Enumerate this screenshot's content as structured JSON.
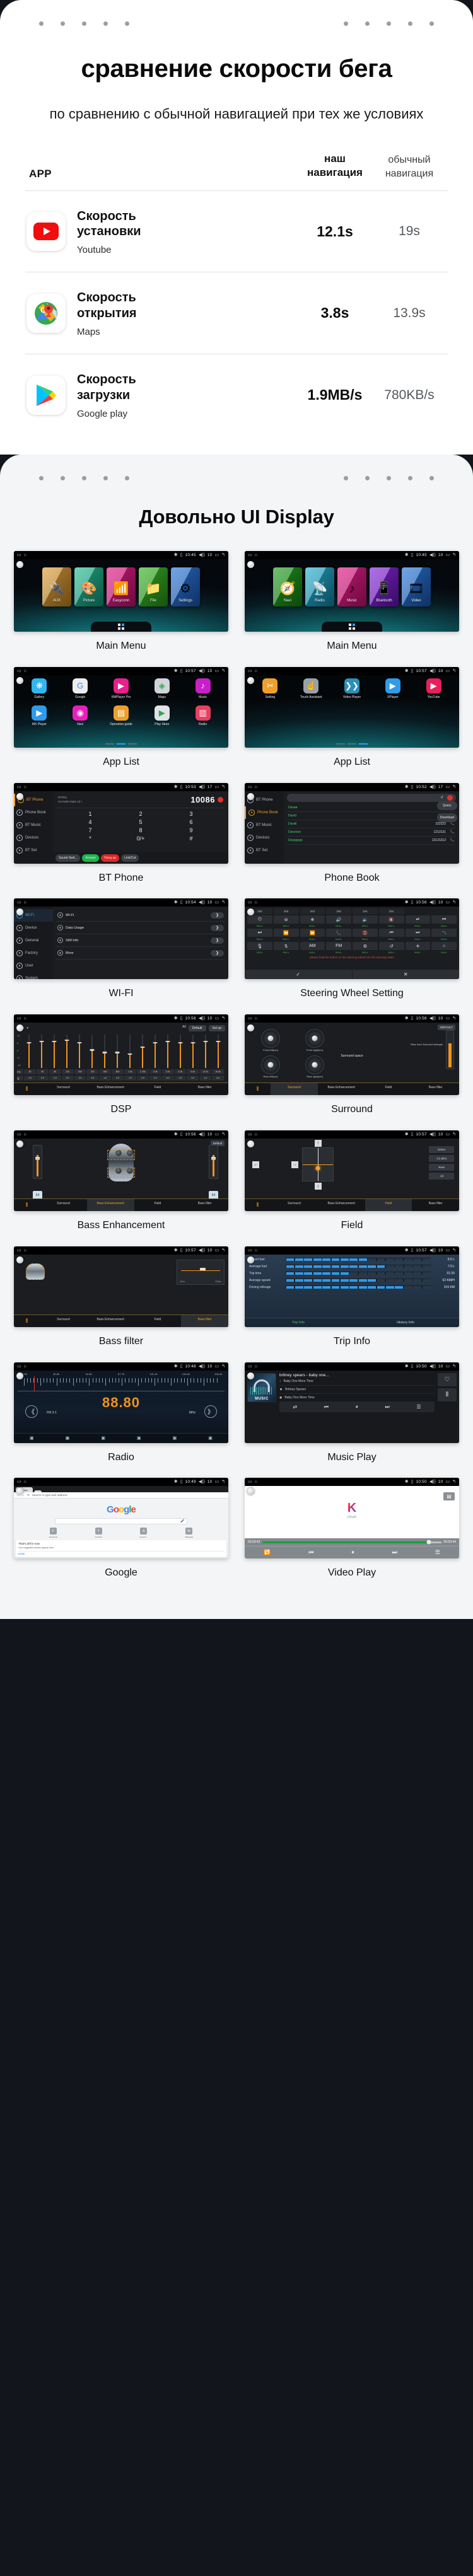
{
  "section1": {
    "title": "сравнение скорости бега",
    "subtitle": "по сравнению с обычной навигацией при тех же условиях",
    "table": {
      "header": {
        "app": "APP",
        "ours_line1": "наш",
        "ours_line2": "навигация",
        "normal_line1": "обычный",
        "normal_line2": "навигация"
      },
      "rows": [
        {
          "icon": "youtube-icon",
          "metric": "Скорость установки",
          "app": "Youtube",
          "ours": "12.1s",
          "normal": "19s"
        },
        {
          "icon": "google-maps-icon",
          "metric": "Скорость открытия",
          "app": "Maps",
          "ours": "3.8s",
          "normal": "13.9s"
        },
        {
          "icon": "google-play-icon",
          "metric": "Скорость загрузки",
          "app": "Google play",
          "ours": "1.9MB/s",
          "normal": "780KB/s"
        }
      ]
    }
  },
  "section2": {
    "title": "Довольно UI Display",
    "items": [
      {
        "caption": "Main Menu",
        "kind": "main-menu-a",
        "status": {
          "time": "10:45",
          "vol": "10"
        },
        "tiles": [
          {
            "label": "AUX",
            "icon": "rca-cables-icon",
            "c1": "#e0a341",
            "c2": "#8a5f17"
          },
          {
            "label": "Picture",
            "icon": "palette-icon",
            "c1": "#2cc39a",
            "c2": "#0c6b55"
          },
          {
            "label": "Easyconn",
            "icon": "phone-wifi-icon",
            "c1": "#e81f8c",
            "c2": "#8e0d52"
          },
          {
            "label": "File",
            "icon": "folder-search-icon",
            "c1": "#3fbc2a",
            "c2": "#1c6b12"
          },
          {
            "label": "Settings",
            "icon": "gear-icon",
            "c1": "#2f7de0",
            "c2": "#123f80"
          }
        ]
      },
      {
        "caption": "Main Menu",
        "kind": "main-menu-b",
        "status": {
          "time": "10:45",
          "vol": "10"
        },
        "tiles": [
          {
            "label": "Navi",
            "icon": "compass-icon",
            "c1": "#2aa32a",
            "c2": "#0d5f0d"
          },
          {
            "label": "Radio",
            "icon": "radio-tower-icon",
            "c1": "#2bb6d6",
            "c2": "#0d5f78"
          },
          {
            "label": "Music",
            "icon": "music-note-icon",
            "c1": "#e81f8c",
            "c2": "#8e0d52"
          },
          {
            "label": "Bluetooth",
            "icon": "bluetooth-phone-icon",
            "c1": "#8c2ce0",
            "c2": "#4a0d87"
          },
          {
            "label": "Video",
            "icon": "film-reel-icon",
            "c1": "#2f7de0",
            "c2": "#123f80"
          }
        ]
      },
      {
        "caption": "App List",
        "kind": "app-list-a",
        "status": {
          "time": "10:57",
          "vol": "10"
        },
        "apps": [
          {
            "label": "Gallery",
            "glyph": "❋",
            "bg": "#33b5f0"
          },
          {
            "label": "Google",
            "glyph": "G",
            "bg": "#ededed",
            "fg": "#4285f4"
          },
          {
            "label": "KMPlayer Pro",
            "glyph": "▶",
            "bg": "#e81f8c"
          },
          {
            "label": "Maps",
            "glyph": "◈",
            "bg": "#cfd4d8",
            "fg": "#34a853"
          },
          {
            "label": "Music",
            "glyph": "♪",
            "bg": "#c91fc9"
          },
          {
            "label": "MX Player",
            "glyph": "▶",
            "bg": "#2f9bea"
          },
          {
            "label": "Navi",
            "glyph": "◉",
            "bg": "#e81fbe"
          },
          {
            "label": "Operation guide",
            "glyph": "▤",
            "bg": "#f0a02a"
          },
          {
            "label": "Play Store",
            "glyph": "▶",
            "bg": "#dfe3e6",
            "fg": "#34a853"
          },
          {
            "label": "Radio",
            "glyph": "▥",
            "bg": "#e84060"
          }
        ],
        "page_active": 1
      },
      {
        "caption": "App List",
        "kind": "app-list-b",
        "status": {
          "time": "10:57",
          "vol": "10"
        },
        "apps": [
          {
            "label": "Setting",
            "glyph": "✂",
            "bg": "#f0a02a"
          },
          {
            "label": "Touch Assistant",
            "glyph": "☝",
            "bg": "#9aa0a6"
          },
          {
            "label": "Video Player",
            "glyph": "❯❯",
            "bg": "#2b8fb8"
          },
          {
            "label": "XPlayer",
            "glyph": "▶",
            "bg": "#2f9bea"
          },
          {
            "label": "YouTube",
            "glyph": "▶",
            "bg": "#e81f5c"
          }
        ],
        "page_active": 2
      },
      {
        "caption": "BT Phone",
        "kind": "bt-phone",
        "status": {
          "time": "10:53",
          "vol": "17"
        },
        "side": [
          {
            "label": "BT Phone",
            "icon": "dialpad-icon",
            "state": "act"
          },
          {
            "label": "Phone Book",
            "icon": "contact-icon",
            "state": ""
          },
          {
            "label": "BT Music",
            "icon": "music-note-icon",
            "state": ""
          },
          {
            "label": "Devices",
            "icon": "bluetooth-icon",
            "state": ""
          },
          {
            "label": "BT Set",
            "icon": "gear-icon",
            "state": ""
          }
        ],
        "dial": {
          "status_line1": "Dialing",
          "status_line2": "HUAWEI Mate 20 l",
          "number": "10086",
          "corner": "10086",
          "keys": [
            "1",
            "2",
            "3",
            "4",
            "5",
            "6",
            "7",
            "8",
            "9",
            "*",
            "0/+",
            "#"
          ],
          "buttons": [
            "Sound Swit...",
            "Answer",
            "Hang up",
            "Link/Cut"
          ]
        }
      },
      {
        "caption": "Phone Book",
        "kind": "phone-book",
        "status": {
          "time": "10:52",
          "vol": "17"
        },
        "side": [
          {
            "label": "BT Phone",
            "icon": "dialpad-icon",
            "state": ""
          },
          {
            "label": "Phone Book",
            "icon": "contact-icon",
            "state": "act"
          },
          {
            "label": "BT Music",
            "icon": "music-note-icon",
            "state": ""
          },
          {
            "label": "Devices",
            "icon": "bluetooth-icon",
            "state": ""
          },
          {
            "label": "BT Set",
            "icon": "gear-icon",
            "state": ""
          }
        ],
        "search_value": "d",
        "contacts": [
          {
            "name": "Davaa",
            "phone": "1111"
          },
          {
            "name": "David",
            "phone": "11111"
          },
          {
            "name": "Daviiii",
            "phone": "222222"
          },
          {
            "name": "Davoooo",
            "phone": "1213131"
          },
          {
            "name": "Davppppp",
            "phone": "12121212"
          }
        ],
        "buttons": [
          "Query",
          "Download"
        ]
      },
      {
        "caption": "WI-FI",
        "kind": "wifi",
        "status": {
          "time": "10:54",
          "vol": "10"
        },
        "side": [
          {
            "label": "Wi-Fi",
            "icon": "wifi-icon",
            "state": "actb"
          },
          {
            "label": "Device",
            "icon": "device-icon",
            "state": ""
          },
          {
            "label": "General",
            "icon": "gear-icon",
            "state": ""
          },
          {
            "label": "Factory",
            "icon": "tools-icon",
            "state": ""
          },
          {
            "label": "User",
            "icon": "user-icon",
            "state": ""
          },
          {
            "label": "System",
            "icon": "system-icon",
            "state": ""
          }
        ],
        "rows": [
          "WI-FI",
          "Data Usage",
          "SIM Info",
          "More"
        ]
      },
      {
        "caption": "Steering Wheel Setting",
        "kind": "steering",
        "status": {
          "time": "10:56",
          "vol": "10"
        },
        "values": [
          "255",
          "255",
          "253",
          "255",
          "254",
          "254"
        ],
        "keys_r1": [
          "⏻",
          "⊜",
          "❄",
          "🔊",
          "🔉",
          "🔇",
          "⏯",
          "⏮"
        ],
        "keys_r2": [
          "⏭",
          "⏪",
          "⏩",
          "📞",
          "📵",
          "⏮",
          "⏭",
          "〽"
        ],
        "keys_r3": [
          "🎙",
          "⇅",
          "AM",
          "FM",
          "⚙",
          "↺",
          "✛",
          "⌂"
        ],
        "null_label": "NULL",
        "note": "please hold the button on the steering wheel into the learning state!",
        "confirm": "✓",
        "cancel": "✕"
      },
      {
        "caption": "DSP",
        "kind": "dsp",
        "status": {
          "time": "10:56",
          "vol": "10"
        },
        "preset": "Rock",
        "top_buttons": [
          "All",
          "Default",
          "Set up"
        ],
        "y_labels": [
          "12",
          "6",
          "0",
          "-6",
          "-12"
        ],
        "fc_label": "FC",
        "q_label": "Q",
        "fc": [
          "30",
          "50",
          "80",
          "125",
          "200",
          "315",
          "500",
          "800",
          "1.0k",
          "1.25k",
          "2.0k",
          "3.0k",
          "5.0k",
          "6.0k",
          "12.0k",
          "16.0k"
        ],
        "q": [
          "1.0",
          "2.0",
          "1.0",
          "2.0",
          "1.0",
          "2.0",
          "1.0",
          "2.0",
          "1.0",
          "2.0",
          "1.0",
          "2.0",
          "2.0",
          "2.0",
          "1.0",
          "2.0"
        ],
        "gains": [
          6,
          7,
          7,
          8,
          6,
          1,
          -1,
          -1,
          -2,
          3,
          6,
          7,
          6,
          6,
          7,
          7
        ],
        "tabs": [
          "Surround",
          "Bass Enhancement",
          "Field",
          "Bass filter"
        ],
        "tab_active": -1
      },
      {
        "caption": "Surround",
        "kind": "surround",
        "status": {
          "time": "10:56",
          "vol": "10"
        },
        "dials": [
          "Front left(cm)",
          "Front right(cm)",
          "Rear left(cm)",
          "Rear right(cm)"
        ],
        "center_label": "Surround space",
        "right_label": "Rear horn Surround strength",
        "default_btn": "DEFAULT",
        "tabs": [
          "Surround",
          "Bass Enhancement",
          "Field",
          "Bass filter"
        ],
        "tab_active": 0
      },
      {
        "caption": "Bass Enhancement",
        "kind": "bass-enh",
        "status": {
          "time": "10:56",
          "vol": "10"
        },
        "default_btn": "Default",
        "slot_labels": [
          "front(%)",
          "rear(%)"
        ],
        "values": [
          "64",
          "64"
        ],
        "tabs": [
          "Surround",
          "Bass Enhancement",
          "Field",
          "Bass filter"
        ],
        "tab_active": 1
      },
      {
        "caption": "Field",
        "kind": "field",
        "status": {
          "time": "10:57",
          "vol": "10"
        },
        "buttons": [
          "Driver",
          "Co-pilot",
          "Rear",
          "All"
        ],
        "tabs": [
          "Surround",
          "Bass Enhancement",
          "Field",
          "Bass filter"
        ],
        "tab_active": 2
      },
      {
        "caption": "Bass filter",
        "kind": "bass-filter",
        "status": {
          "time": "10:57",
          "vol": "10"
        },
        "graph": {
          "low": "20Hz",
          "high": "250Hz"
        },
        "tabs": [
          "Surround",
          "Bass Enhancement",
          "Field",
          "Bass filter"
        ],
        "tab_active": 3
      },
      {
        "caption": "Trip Info",
        "kind": "trip",
        "status": {
          "time": "10:57",
          "vol": "10"
        },
        "rows": [
          {
            "label": "Instant fuel",
            "value": "8.6 L",
            "fill": 9
          },
          {
            "label": "Average fuel",
            "value": "7.9 L",
            "fill": 11
          },
          {
            "label": "Trip time",
            "value": "01:25",
            "fill": 7
          },
          {
            "label": "Average speed",
            "value": "62 KM/H",
            "fill": 10
          },
          {
            "label": "Driving mileage",
            "value": "316 KM",
            "fill": 13
          }
        ],
        "tabs": [
          "Trip Info",
          "History Info"
        ],
        "tab_active": 0
      },
      {
        "caption": "Radio",
        "kind": "radio",
        "status": {
          "time": "10:48",
          "vol": "10"
        },
        "frequency": "88.80",
        "band": "FM 3-1",
        "unit": "MHz",
        "scale": [
          "87.50",
          "90.90",
          "94.35",
          "97.75",
          "101.15",
          "104.60",
          "108.00"
        ],
        "bottom_icons": [
          "list-icon",
          "band-icon",
          "scan-icon",
          "prev-icon",
          "next-icon",
          "eq-icon"
        ]
      },
      {
        "caption": "Music Play",
        "kind": "music",
        "status": {
          "time": "10:50",
          "vol": "10"
        },
        "title": "britney spears - baby one...",
        "meta": [
          {
            "icon": "note-icon",
            "text": "Baby One More Time"
          },
          {
            "icon": "artist-icon",
            "text": "Britney Spears"
          },
          {
            "icon": "album-icon",
            "text": "Baby One More Time"
          }
        ],
        "art_text": "MUSIC",
        "right_buttons": [
          "heart-icon",
          "eq-icon"
        ],
        "controls": [
          "shuffle-icon",
          "prev-icon",
          "play-icon",
          "next-icon",
          "list-icon"
        ]
      },
      {
        "caption": "Google",
        "kind": "google",
        "status": {
          "time": "10:49",
          "vol": "10"
        },
        "tab_label": "New tab",
        "url_placeholder": "Search or type web address",
        "logo": [
          "G",
          "o",
          "o",
          "g",
          "l",
          "e"
        ],
        "tiles": [
          {
            "letter": "F",
            "label": "Facebook"
          },
          {
            "letter": "Y",
            "label": "YouTube"
          },
          {
            "letter": "A",
            "label": "Amazon..."
          },
          {
            "letter": "W",
            "label": "Wikipedia"
          },
          {
            "letter": "E",
            "label": "ESPN.com"
          },
          {
            "letter": "Y",
            "label": "Yahoo"
          },
          {
            "letter": "E",
            "label": "eBay"
          },
          {
            "letter": "I",
            "label": "Instagram"
          }
        ],
        "card_title": "That's all for now",
        "card_sub": "Your suggested articles appear here",
        "card_more": "MORE"
      },
      {
        "caption": "Video Play",
        "kind": "video",
        "status": {
          "time": "10:50",
          "vol": "10"
        },
        "logo_letter": "K",
        "logo_name": "1theK",
        "current_time": "00:03:42",
        "total_time": "00:03:44",
        "progress_pct": 93,
        "controls": [
          "repeat-icon",
          "prev-icon",
          "pause-icon",
          "next-icon",
          "list-icon"
        ]
      }
    ]
  }
}
